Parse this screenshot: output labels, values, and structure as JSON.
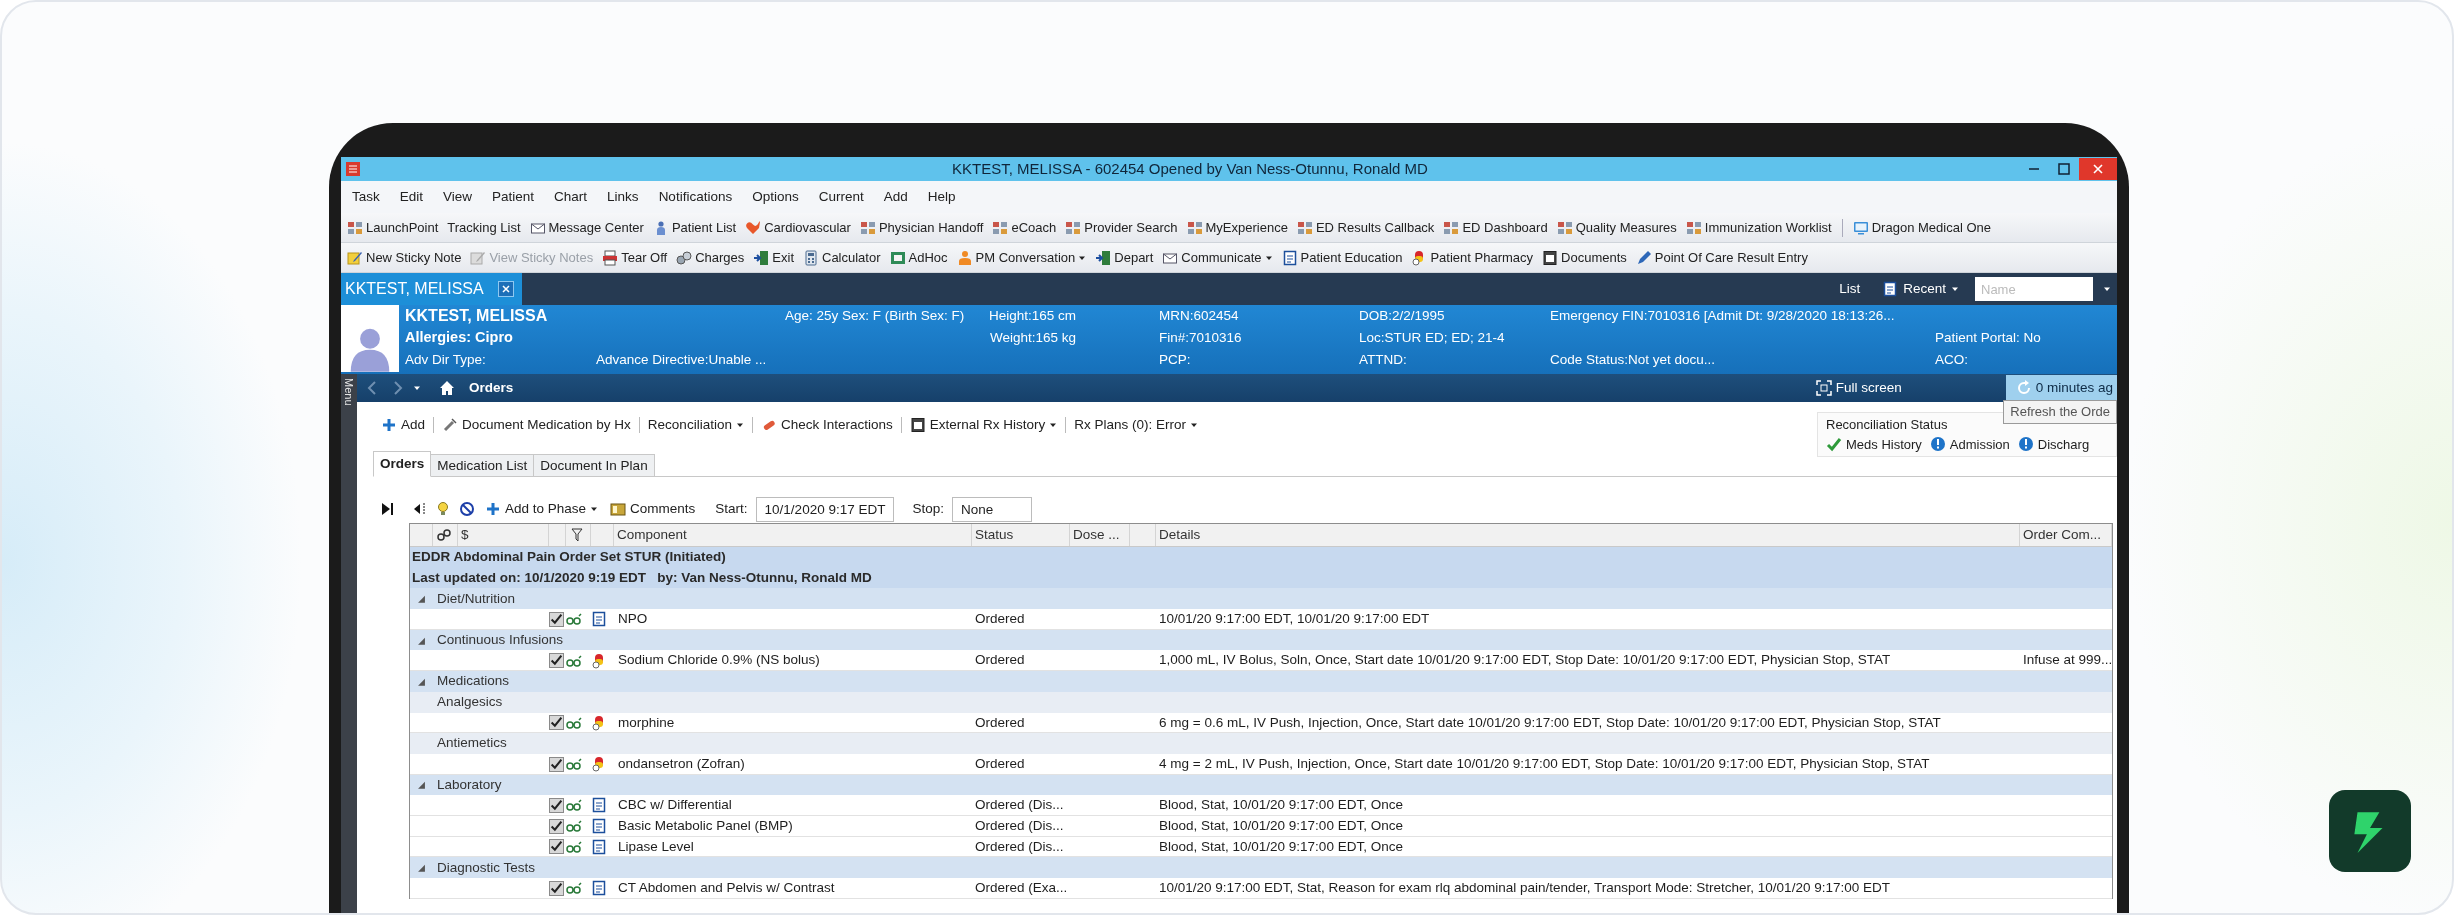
{
  "window": {
    "title": "KKTEST, MELISSA - 602454 Opened by Van Ness-Otunnu, Ronald MD"
  },
  "menu": [
    "Task",
    "Edit",
    "View",
    "Patient",
    "Chart",
    "Links",
    "Notifications",
    "Options",
    "Current",
    "Add",
    "Help"
  ],
  "toolbar_1": [
    {
      "label": "LaunchPoint"
    },
    {
      "label": "Tracking List"
    },
    {
      "label": "Message Center"
    },
    {
      "label": "Patient List"
    },
    {
      "label": "Cardiovascular"
    },
    {
      "label": "Physician Handoff"
    },
    {
      "label": "eCoach"
    },
    {
      "label": "Provider Search"
    },
    {
      "label": "MyExperience"
    },
    {
      "label": "ED Results Callback"
    },
    {
      "label": "ED Dashboard"
    },
    {
      "label": "Quality Measures"
    },
    {
      "label": "Immunization Worklist"
    },
    {
      "label": "Dragon Medical One"
    }
  ],
  "toolbar_2": [
    {
      "label": "New Sticky Note",
      "disabled": false,
      "dropdown": false
    },
    {
      "label": "View Sticky Notes",
      "disabled": true,
      "dropdown": false
    },
    {
      "label": "Tear Off",
      "disabled": false,
      "dropdown": false
    },
    {
      "label": "Charges",
      "disabled": false,
      "dropdown": false
    },
    {
      "label": "Exit",
      "disabled": false,
      "dropdown": false
    },
    {
      "label": "Calculator",
      "disabled": false,
      "dropdown": false
    },
    {
      "label": "AdHoc",
      "disabled": false,
      "dropdown": false
    },
    {
      "label": "PM Conversation",
      "disabled": false,
      "dropdown": true
    },
    {
      "label": "Depart",
      "disabled": false,
      "dropdown": false
    },
    {
      "label": "Communicate",
      "disabled": false,
      "dropdown": true
    },
    {
      "label": "Patient Education",
      "disabled": false,
      "dropdown": false
    },
    {
      "label": "Patient Pharmacy",
      "disabled": false,
      "dropdown": false
    },
    {
      "label": "Documents",
      "disabled": false,
      "dropdown": false
    },
    {
      "label": "Point Of Care Result Entry",
      "disabled": false,
      "dropdown": false
    }
  ],
  "patient_tab": {
    "label": "KKTEST, MELISSA"
  },
  "patient_search": {
    "list": "List",
    "recent": "Recent",
    "placeholder": "Name"
  },
  "banner": {
    "name": "KKTEST, MELISSA",
    "allergies": "Allergies: Cipro",
    "adv_dir_type": "Adv Dir Type:",
    "advance_directive": "Advance Directive:Unable ...",
    "age_sex": "Age: 25y Sex: F (Birth Sex: F)",
    "height": "Height:165 cm",
    "weight": "Weight:165 kg",
    "mrn": "MRN:602454",
    "fin": "Fin#:7010316",
    "pcp": "PCP:",
    "dob": "DOB:2/2/1995",
    "location": "Loc:STUR ED; ED; 21-4",
    "attnd": "ATTND:",
    "emergency_fin": "Emergency FIN:7010316 [Admit Dt: 9/28/2020 18:13:26...",
    "code_status": "Code Status:Not yet docu...",
    "patient_portal": "Patient Portal: No",
    "aco": "ACO:"
  },
  "side_menu": {
    "label": "Menu"
  },
  "nav": {
    "page": "Orders",
    "full_screen": "Full screen",
    "refresh": "0 minutes ag",
    "tooltip": "Refresh the Orde"
  },
  "actions": [
    {
      "label": "Add",
      "dropdown": false
    },
    {
      "label": "Document Medication by Hx",
      "dropdown": false
    },
    {
      "label": "Reconciliation",
      "dropdown": true
    },
    {
      "label": "Check Interactions",
      "dropdown": false
    },
    {
      "label": "External Rx History",
      "dropdown": true
    },
    {
      "label": "Rx Plans (0): Error",
      "dropdown": true
    }
  ],
  "reconciliation": {
    "title": "Reconciliation Status",
    "items": [
      {
        "label": "Meds History",
        "complete": true
      },
      {
        "label": "Admission",
        "complete": false
      },
      {
        "label": "Discharg",
        "complete": false
      }
    ]
  },
  "tabs": [
    {
      "label": "Orders",
      "selected": true
    },
    {
      "label": "Medication List",
      "selected": false
    },
    {
      "label": "Document In Plan",
      "selected": false
    }
  ],
  "phase_toolbar": {
    "add_to_phase": "Add to Phase",
    "comments": "Comments",
    "start_label": "Start:",
    "start_value": "10/1/2020 9:17 EDT",
    "stop_label": "Stop:",
    "stop_value": "None"
  },
  "grid": {
    "columns": {
      "cost": "$",
      "component": "Component",
      "status": "Status",
      "dose": "Dose ...",
      "details": "Details",
      "order_comment": "Order Com..."
    },
    "rows": [
      {
        "kind": "phase",
        "text": "EDDR Abdominal Pain Order Set STUR (Initiated)"
      },
      {
        "kind": "phase",
        "text": "Last updated on: 10/1/2020 9:19 EDT   by: Van Ness-Otunnu, Ronald MD"
      },
      {
        "kind": "category",
        "text": "Diet/Nutrition",
        "expanded": true
      },
      {
        "kind": "order",
        "medication": false,
        "checked": true,
        "component": "NPO",
        "status": "Ordered",
        "details": "10/01/20 9:17:00 EDT, 10/01/20 9:17:00 EDT"
      },
      {
        "kind": "category",
        "text": "Continuous Infusions",
        "expanded": true
      },
      {
        "kind": "order",
        "medication": true,
        "checked": true,
        "component": "Sodium Chloride 0.9% (NS bolus)",
        "status": "Ordered",
        "details": "1,000 mL, IV Bolus, Soln, Once, Start date 10/01/20 9:17:00 EDT, Stop Date: 10/01/20 9:17:00 EDT, Physician Stop, STAT",
        "order_comment": "Infuse at 999..."
      },
      {
        "kind": "category",
        "text": "Medications",
        "expanded": true
      },
      {
        "kind": "subcategory",
        "text": "Analgesics"
      },
      {
        "kind": "order",
        "medication": true,
        "checked": true,
        "component": "morphine",
        "status": "Ordered",
        "details": "6 mg = 0.6 mL, IV Push, Injection, Once, Start date 10/01/20 9:17:00 EDT, Stop Date: 10/01/20 9:17:00 EDT, Physician Stop, STAT"
      },
      {
        "kind": "subcategory",
        "text": "Antiemetics"
      },
      {
        "kind": "order",
        "medication": true,
        "checked": true,
        "component": "ondansetron (Zofran)",
        "status": "Ordered",
        "details": "4 mg = 2 mL, IV Push, Injection, Once, Start date 10/01/20 9:17:00 EDT, Stop Date: 10/01/20 9:17:00 EDT, Physician Stop, STAT"
      },
      {
        "kind": "category",
        "text": "Laboratory",
        "expanded": true
      },
      {
        "kind": "order",
        "medication": false,
        "checked": true,
        "component": "CBC w/ Differential",
        "status": "Ordered (Dis...",
        "details": "Blood, Stat, 10/01/20 9:17:00 EDT, Once"
      },
      {
        "kind": "order",
        "medication": false,
        "checked": true,
        "component": "Basic Metabolic Panel (BMP)",
        "status": "Ordered (Dis...",
        "details": "Blood, Stat, 10/01/20 9:17:00 EDT, Once"
      },
      {
        "kind": "order",
        "medication": false,
        "checked": true,
        "component": "Lipase Level",
        "status": "Ordered (Dis...",
        "details": "Blood, Stat, 10/01/20 9:17:00 EDT, Once"
      },
      {
        "kind": "category",
        "text": "Diagnostic Tests",
        "expanded": true
      },
      {
        "kind": "order",
        "medication": false,
        "checked": true,
        "component": "CT Abdomen and Pelvis w/ Contrast",
        "status": "Ordered (Exa...",
        "details": "10/01/20 9:17:00 EDT, Stat, Reason for exam rlq abdominal pain/tender, Transport Mode: Stretcher, 10/01/20 9:17:00 EDT"
      }
    ]
  }
}
